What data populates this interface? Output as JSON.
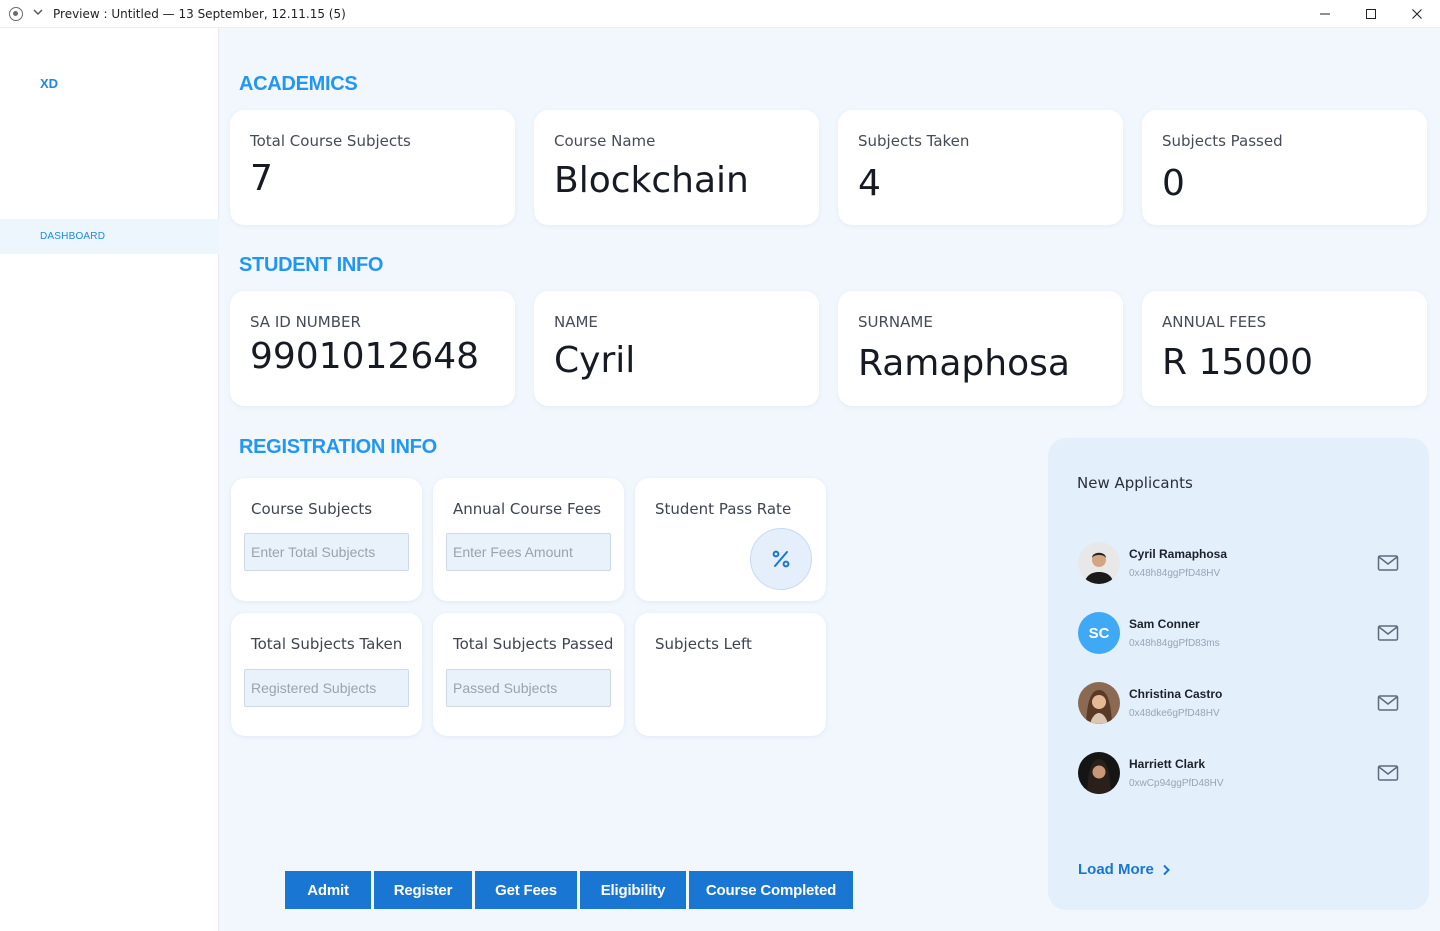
{
  "window": {
    "title": "Preview : Untitled — 13 September, 12.11.15 (5)"
  },
  "sidebar": {
    "logo": "XD",
    "items": [
      {
        "label": "DASHBOARD",
        "active": true
      }
    ]
  },
  "academics": {
    "title": "ACADEMICS",
    "cards": [
      {
        "label": "Total Course Subjects",
        "value": "7"
      },
      {
        "label": "Course Name",
        "value": "Blockchain"
      },
      {
        "label": "Subjects Taken",
        "value": "4"
      },
      {
        "label": "Subjects Passed",
        "value": "0"
      }
    ]
  },
  "student_info": {
    "title": "STUDENT INFO",
    "cards": [
      {
        "label": "SA ID NUMBER",
        "value": "9901012648"
      },
      {
        "label": "NAME",
        "value": "Cyril"
      },
      {
        "label": "SURNAME",
        "value": "Ramaphosa"
      },
      {
        "label": "ANNUAL FEES",
        "value": "R 15000"
      }
    ]
  },
  "registration": {
    "title": "REGISTRATION INFO",
    "course_subjects": {
      "label": "Course Subjects",
      "placeholder": "Enter Total Subjects"
    },
    "annual_course_fees": {
      "label": "Annual Course Fees",
      "placeholder": "Enter Fees Amount"
    },
    "student_pass_rate": {
      "label": "Student Pass Rate",
      "icon": "percent-icon",
      "glyph": "%"
    },
    "total_subjects_taken": {
      "label": "Total Subjects Taken",
      "placeholder": "Registered Subjects"
    },
    "total_subjects_passed": {
      "label": "Total Subjects Passed",
      "placeholder": "Passed Subjects"
    },
    "subjects_left": {
      "label": "Subjects Left"
    }
  },
  "actions": {
    "admit": "Admit",
    "register": "Register",
    "get_fees": "Get Fees",
    "eligibility": "Eligibility",
    "course_completed": "Course Completed"
  },
  "applicants": {
    "title": "New Applicants",
    "items": [
      {
        "name": "Cyril Ramaphosa",
        "address": "0x48h84ggPfD48HV",
        "avatar": "photo"
      },
      {
        "name": "Sam Conner",
        "address": "0x48h84ggPfD83ms",
        "avatar": "initials",
        "initials": "SC"
      },
      {
        "name": "Christina Castro",
        "address": "0x48dke6gPfD48HV",
        "avatar": "photo"
      },
      {
        "name": "Harriett Clark",
        "address": "0xwCp94ggPfD48HV",
        "avatar": "photo"
      }
    ],
    "load_more": "Load More"
  },
  "colors": {
    "accent": "#2196f3",
    "button": "#1976d2",
    "panel": "#e4effc",
    "background": "#f1f7fd"
  }
}
